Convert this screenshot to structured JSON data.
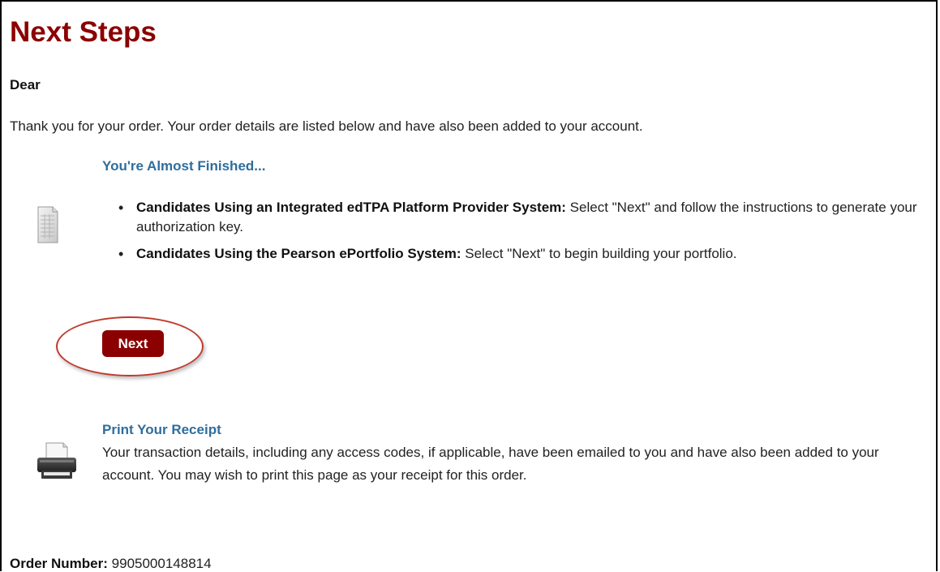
{
  "page": {
    "title": "Next Steps",
    "greeting": "Dear",
    "intro": "Thank you for your order. Your order details are listed below and have also been added to your account."
  },
  "almost_finished": {
    "heading": "You're Almost Finished...",
    "items": [
      {
        "lead": "Candidates Using an Integrated edTPA Platform Provider System:",
        "text": " Select \"Next\" and follow the instructions to generate your authorization key."
      },
      {
        "lead": "Candidates Using the Pearson ePortfolio System:",
        "text": " Select \"Next\" to begin building your portfolio."
      }
    ],
    "next_label": "Next"
  },
  "receipt": {
    "title": "Print Your Receipt",
    "text": "Your transaction details, including any access codes, if applicable, have been emailed to you and have also been added to your account. You may wish to print this page as your receipt for this order."
  },
  "order": {
    "label": "Order Number:",
    "value": "9905000148814"
  },
  "colors": {
    "title": "#8b0000",
    "heading": "#2e6e9e",
    "button": "#8b0000",
    "highlight": "#c0392b"
  },
  "icons": {
    "document": "document-icon",
    "printer": "printer-icon"
  }
}
